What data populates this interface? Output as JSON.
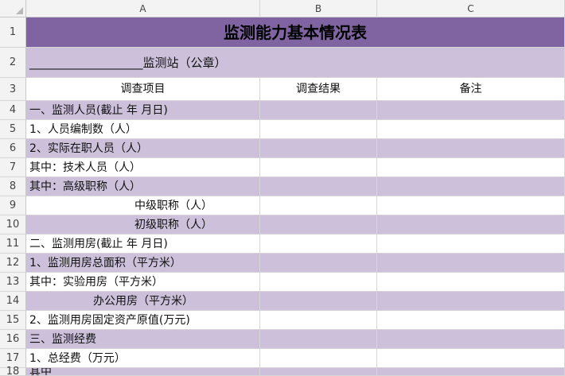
{
  "columns": [
    "A",
    "B",
    "C"
  ],
  "row_numbers": [
    "1",
    "2",
    "3",
    "4",
    "5",
    "6",
    "7",
    "8",
    "9",
    "10",
    "11",
    "12",
    "13",
    "14",
    "15",
    "16",
    "17",
    "18"
  ],
  "title": "监测能力基本情况表",
  "subtitle": "___________________监测站（公章）",
  "headers": {
    "item": "调查项目",
    "result": "调查结果",
    "note": "备注"
  },
  "rows": [
    {
      "label": "一、监测人员(截止 年 月日)"
    },
    {
      "label": "1、人员编制数（人）"
    },
    {
      "label": "2、实际在职人员（人）"
    },
    {
      "label": "其中：技术人员（人）"
    },
    {
      "label": "    其中：高级职称（人）"
    },
    {
      "label": "中级职称（人）"
    },
    {
      "label": "初级职称（人）"
    },
    {
      "label": "二、监测用房(截止 年 月日)"
    },
    {
      "label": "1、监测用房总面积（平方米）"
    },
    {
      "label": "其中：实验用房（平方米）"
    },
    {
      "label": "办公用房（平方米）"
    },
    {
      "label": "2、监测用房固定资产原值(万元)"
    },
    {
      "label": "三、监测经费"
    },
    {
      "label": "1、总经费（万元）"
    },
    {
      "label": "其中"
    }
  ],
  "colors": {
    "title_bg": "#8064a2",
    "band": "#ccc0da",
    "white": "#ffffff",
    "header_bg": "#f3f3f3"
  }
}
